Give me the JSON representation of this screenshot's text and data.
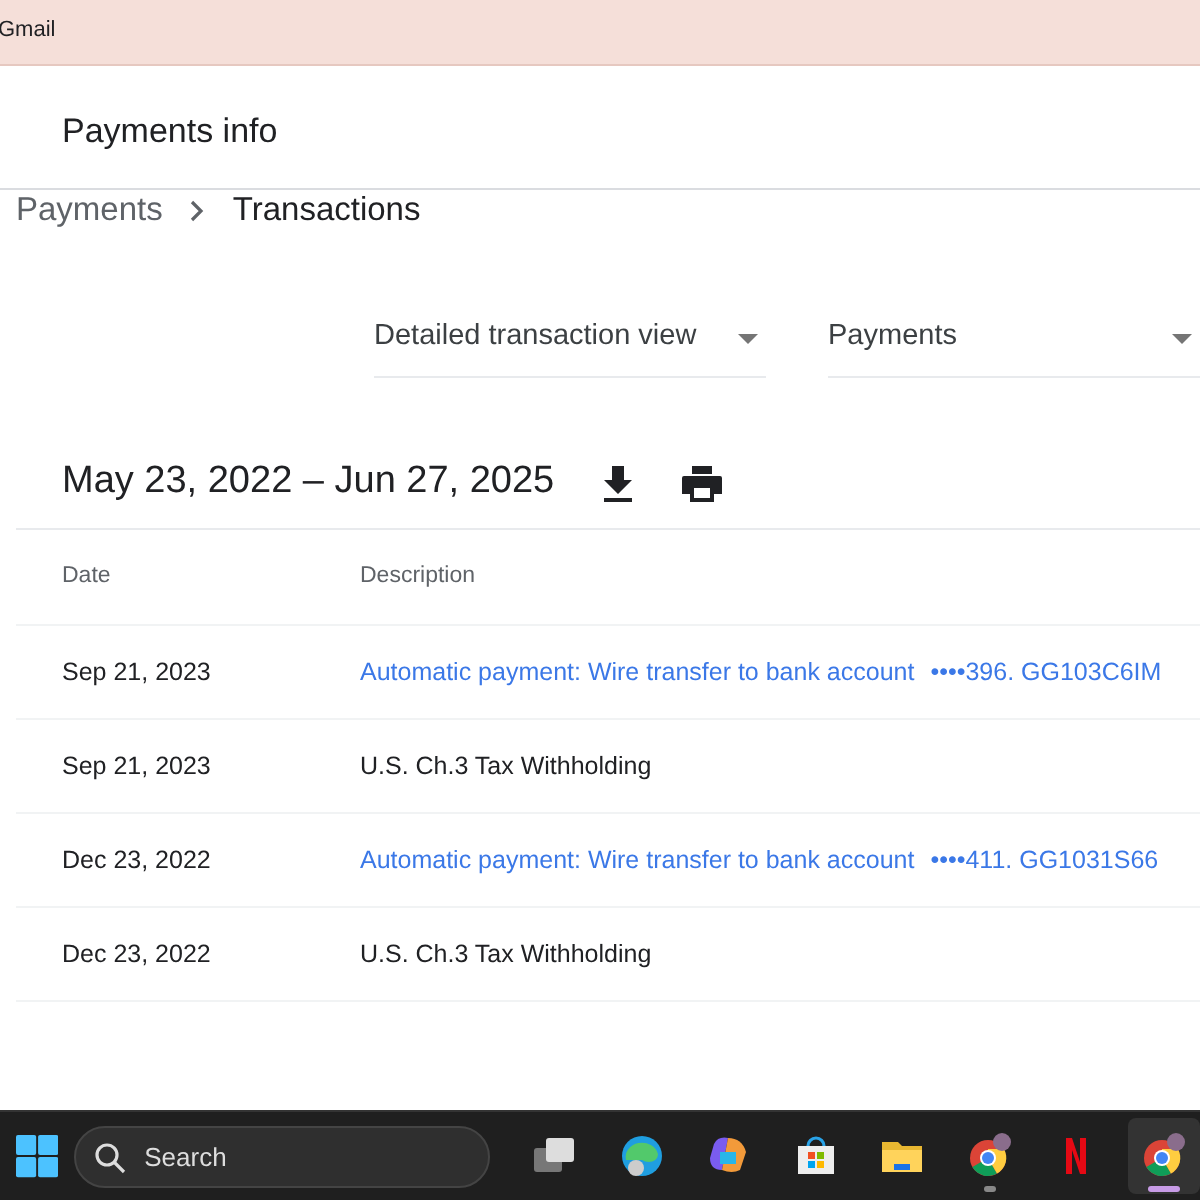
{
  "browser_tab": {
    "title": "Gmail"
  },
  "header": {
    "title": "Payments info"
  },
  "breadcrumb": [
    {
      "label": "Payments",
      "current": false
    },
    {
      "label": "Transactions",
      "current": true
    }
  ],
  "filters": [
    {
      "value": "Detailed transaction view"
    },
    {
      "value": "Payments"
    }
  ],
  "date_range": "May 23, 2022 – Jun 27, 2025",
  "table": {
    "columns": [
      "Date",
      "Description"
    ],
    "rows": [
      {
        "date": "Sep 21, 2023",
        "kind": "link",
        "description": "Automatic payment: Wire transfer to bank account",
        "reference": "••••396. GG103C6IM"
      },
      {
        "date": "Sep 21, 2023",
        "kind": "plain",
        "description": "U.S. Ch.3 Tax Withholding"
      },
      {
        "date": "Dec 23, 2022",
        "kind": "link",
        "description": "Automatic payment: Wire transfer to bank account",
        "reference": "••••411. GG1031S66"
      },
      {
        "date": "Dec 23, 2022",
        "kind": "plain",
        "description": "U.S. Ch.3 Tax Withholding"
      }
    ]
  },
  "taskbar": {
    "search": {
      "placeholder": "Search"
    },
    "apps": [
      {
        "kind": "taskview",
        "active": false
      },
      {
        "kind": "edge",
        "active": false
      },
      {
        "kind": "copilot",
        "active": false
      },
      {
        "kind": "store",
        "active": false
      },
      {
        "kind": "folder",
        "active": false
      },
      {
        "kind": "chrome",
        "active": false
      },
      {
        "kind": "netflix",
        "active": false
      },
      {
        "kind": "chrome",
        "active": true
      }
    ]
  }
}
